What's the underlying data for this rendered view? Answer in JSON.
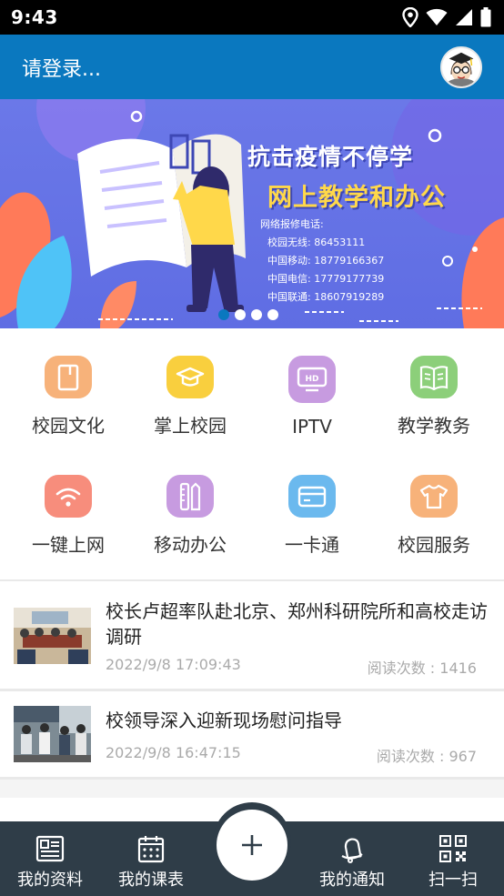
{
  "status_bar": {
    "time": "9:43",
    "icons": [
      "location-icon",
      "wifi-icon",
      "signal-icon",
      "battery-icon"
    ]
  },
  "app_bar": {
    "login_text": "请登录...",
    "avatar_icon": "graduate-avatar-icon"
  },
  "banner": {
    "title1": "抗击疫情不停学",
    "title2": "网上教学和办公",
    "hotline_title": "网络报修电话:",
    "hotlines": [
      "校园无线: 86453111",
      "中国移动: 18779166367",
      "中国电信: 17779177739",
      "中国联通: 18607919289"
    ],
    "slide_count": 4,
    "active_slide": 1
  },
  "menu": [
    {
      "label": "校园文化",
      "icon": "book-icon",
      "color": "#f7b27a"
    },
    {
      "label": "掌上校园",
      "icon": "graduation-cap-icon",
      "color": "#f9cf3e"
    },
    {
      "label": "IPTV",
      "icon": "hd-tv-icon",
      "color": "#c79be0"
    },
    {
      "label": "教学教务",
      "icon": "open-book-icon",
      "color": "#8ccf7a"
    },
    {
      "label": "一键上网",
      "icon": "wifi-icon",
      "color": "#f78d7c"
    },
    {
      "label": "移动办公",
      "icon": "pen-ruler-icon",
      "color": "#c79be0"
    },
    {
      "label": "一卡通",
      "icon": "card-icon",
      "color": "#6bb9ee"
    },
    {
      "label": "校园服务",
      "icon": "shirt-icon",
      "color": "#f7b27a"
    }
  ],
  "news": [
    {
      "title": "校长卢超率队赴北京、郑州科研院所和高校走访调研",
      "date": "2022/9/8 17:09:43",
      "reads": "阅读次数 : 1416"
    },
    {
      "title": "校领导深入迎新现场慰问指导",
      "date": "2022/9/8 16:47:15",
      "reads": "阅读次数 : 967"
    }
  ],
  "bottom_nav": [
    {
      "label": "我的资料",
      "icon": "profile-icon"
    },
    {
      "label": "我的课表",
      "icon": "calendar-icon"
    },
    {
      "label": "我的通知",
      "icon": "bell-icon"
    },
    {
      "label": "扫一扫",
      "icon": "qr-scan-icon"
    }
  ],
  "fab": {
    "icon": "plus-icon"
  },
  "colors": {
    "primary": "#0a78bf",
    "bottom_bar": "#2f3d48",
    "banner_bg": "#6b78e8"
  }
}
